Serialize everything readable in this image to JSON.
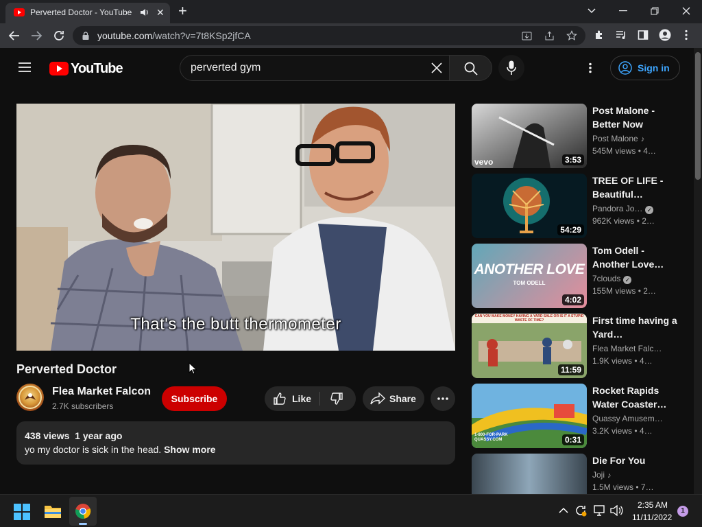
{
  "browser": {
    "tab_title": "Perverted Doctor - YouTube",
    "url_host": "youtube.com",
    "url_path": "/watch?v=7t8KSp2jfCA"
  },
  "youtube": {
    "logo_text": "YouTube",
    "search_value": "perverted gym",
    "sign_in_label": "Sign in"
  },
  "video": {
    "caption": "That's the butt thermometer",
    "title": "Perverted Doctor",
    "channel_name": "Flea Market Falcon",
    "subscribers": "2.7K subscribers",
    "subscribe_label": "Subscribe",
    "like_label": "Like",
    "share_label": "Share",
    "views": "438 views",
    "age": "1 year ago",
    "description": "yo my doctor is sick in the head.",
    "show_more": "Show more"
  },
  "recommendations": [
    {
      "title": "Post Malone - Better Now",
      "channel": "Post Malone",
      "badge": "music",
      "views": "545M views",
      "age": "4…",
      "duration": "3:53",
      "vevo": "vevo"
    },
    {
      "title": "TREE OF LIFE - Beautiful…",
      "channel": "Pandora Jo…",
      "badge": "verified",
      "views": "962K views",
      "age": "2…",
      "duration": "54:29"
    },
    {
      "title": "Tom Odell - Another Love…",
      "channel": "7clouds",
      "badge": "verified",
      "views": "155M views",
      "age": "2…",
      "duration": "4:02",
      "thumb_text": "ANOTHER LOVE",
      "thumb_subtext": "TOM ODELL"
    },
    {
      "title": "First time having a Yard…",
      "channel": "Flea Market Falc…",
      "badge": "",
      "views": "1.9K views",
      "age": "4…",
      "duration": "11:59",
      "thumb_text": "CAN YOU MAKE MONEY HAVING A YARD SALE OR IS IT A STUPID WASTE OF TIME?"
    },
    {
      "title": "Rocket Rapids Water Coaster…",
      "channel": "Quassy Amusem…",
      "badge": "",
      "views": "3.2K views",
      "age": "4…",
      "duration": "0:31",
      "thumb_text": "1-800-FOR-PARK QUASSY.COM"
    },
    {
      "title": "Die For You",
      "channel": "Joji",
      "badge": "music",
      "views": "1.5M views",
      "age": "7…",
      "duration": ""
    }
  ],
  "taskbar": {
    "time": "2:35 AM",
    "date": "11/11/2022",
    "notification_count": "1"
  },
  "colors": {
    "yt_red": "#ff0000",
    "subscribe_red": "#cc0000",
    "link_blue": "#3ea6ff",
    "page_bg": "#0f0f0f"
  },
  "icons": [
    "youtube-favicon",
    "speaker-icon",
    "close-icon",
    "plus-icon",
    "back-icon",
    "forward-icon",
    "reload-icon",
    "lock-icon",
    "menu-icon",
    "search-icon",
    "mic-icon",
    "kebab-icon",
    "account-icon",
    "thumbs-up-icon",
    "thumbs-down-icon",
    "share-icon",
    "windows-start-icon",
    "file-explorer-icon",
    "chrome-icon"
  ]
}
